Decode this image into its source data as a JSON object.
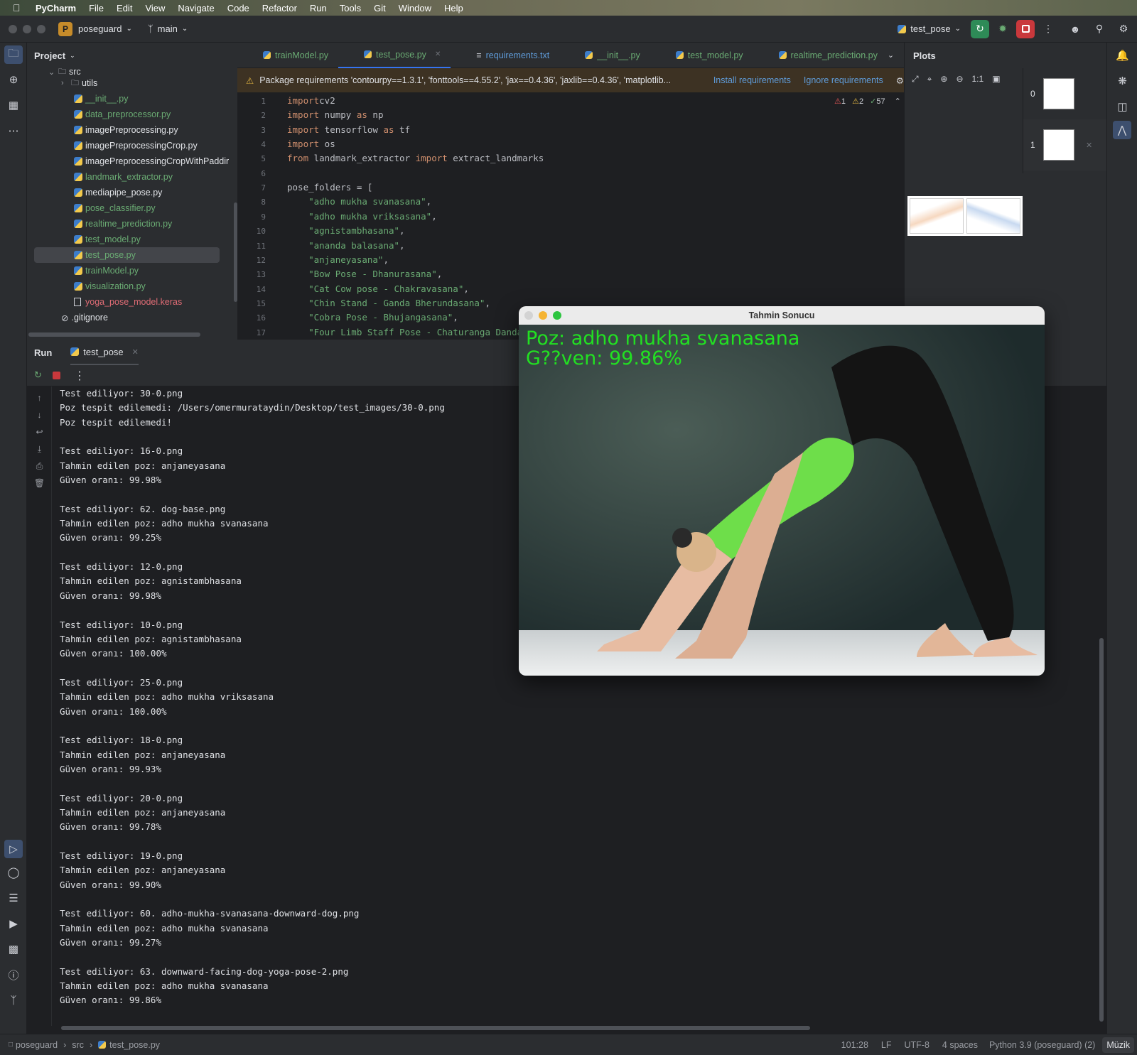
{
  "macbar": {
    "app": "PyCharm",
    "menus": [
      "File",
      "Edit",
      "View",
      "Navigate",
      "Code",
      "Refactor",
      "Run",
      "Tools",
      "Git",
      "Window",
      "Help"
    ]
  },
  "toolbar": {
    "project_badge": "P",
    "project": "poseguard",
    "branch": "main",
    "run_config": "test_pose"
  },
  "project_panel": {
    "title": "Project",
    "items": [
      {
        "name": "src",
        "type": "folder",
        "indent": 1
      },
      {
        "name": "utils",
        "type": "folder",
        "indent": 2
      },
      {
        "name": "__init__.py",
        "type": "py",
        "indent": 3,
        "color": "#6aab73"
      },
      {
        "name": "data_preprocessor.py",
        "type": "py",
        "indent": 3,
        "color": "#6aab73"
      },
      {
        "name": "imagePreprocessing.py",
        "type": "py",
        "indent": 3,
        "color": "#dfe1e5"
      },
      {
        "name": "imagePreprocessingCrop.py",
        "type": "py",
        "indent": 3,
        "color": "#dfe1e5"
      },
      {
        "name": "imagePreprocessingCropWithPaddir",
        "type": "py",
        "indent": 3,
        "color": "#dfe1e5"
      },
      {
        "name": "landmark_extractor.py",
        "type": "py",
        "indent": 3,
        "color": "#6aab73"
      },
      {
        "name": "mediapipe_pose.py",
        "type": "py",
        "indent": 3,
        "color": "#dfe1e5"
      },
      {
        "name": "pose_classifier.py",
        "type": "py",
        "indent": 3,
        "color": "#6aab73"
      },
      {
        "name": "realtime_prediction.py",
        "type": "py",
        "indent": 3,
        "color": "#6aab73"
      },
      {
        "name": "test_model.py",
        "type": "py",
        "indent": 3,
        "color": "#6aab73"
      },
      {
        "name": "test_pose.py",
        "type": "py",
        "indent": 3,
        "color": "#6aab73",
        "selected": true
      },
      {
        "name": "trainModel.py",
        "type": "py",
        "indent": 3,
        "color": "#6aab73"
      },
      {
        "name": "visualization.py",
        "type": "py",
        "indent": 3,
        "color": "#6aab73"
      },
      {
        "name": "yoga_pose_model.keras",
        "type": "file",
        "indent": 3,
        "color": "#e06c75"
      },
      {
        "name": ".gitignore",
        "type": "ignore",
        "indent": 2,
        "color": "#dfe1e5"
      }
    ]
  },
  "editor_tabs": [
    {
      "label": "trainModel.py",
      "color": "#6aab73"
    },
    {
      "label": "test_pose.py",
      "color": "#6aab73",
      "active": true
    },
    {
      "label": "requirements.txt",
      "color": "#5f9bd8"
    },
    {
      "label": "__init__.py",
      "color": "#6aab73"
    },
    {
      "label": "test_model.py",
      "color": "#6aab73"
    },
    {
      "label": "realtime_prediction.py",
      "color": "#6aab73"
    }
  ],
  "banner": {
    "text": "Package requirements 'contourpy==1.3.1', 'fonttools==4.55.2', 'jax==0.4.36', 'jaxlib==0.4.36', 'matplotlib...",
    "install": "Install requirements",
    "ignore": "Ignore requirements"
  },
  "inspections": {
    "errors": "1",
    "warnings": "2",
    "ok": "57"
  },
  "code_lines": [
    {
      "n": "1",
      "parts": [
        [
          "kw",
          "import"
        ],
        [
          "",
          "cv2"
        ]
      ]
    },
    {
      "n": "2",
      "parts": [
        [
          "kw",
          "import"
        ],
        [
          "",
          " numpy "
        ],
        [
          "kw",
          "as"
        ],
        [
          "",
          " np"
        ]
      ]
    },
    {
      "n": "3",
      "parts": [
        [
          "kw",
          "import"
        ],
        [
          "",
          " tensorflow "
        ],
        [
          "kw",
          "as"
        ],
        [
          "",
          " tf"
        ]
      ]
    },
    {
      "n": "4",
      "parts": [
        [
          "kw",
          "import"
        ],
        [
          "",
          " os"
        ]
      ]
    },
    {
      "n": "5",
      "parts": [
        [
          "kw",
          "from"
        ],
        [
          "",
          " landmark_extractor "
        ],
        [
          "kw",
          "import"
        ],
        [
          "",
          " extract_landmarks"
        ]
      ]
    },
    {
      "n": "6",
      "parts": []
    },
    {
      "n": "7",
      "parts": [
        [
          "",
          "pose_folders = ["
        ]
      ]
    },
    {
      "n": "8",
      "parts": [
        [
          "st",
          "    \"adho mukha svanasana\""
        ],
        [
          "",
          ","
        ]
      ]
    },
    {
      "n": "9",
      "parts": [
        [
          "st",
          "    \"adho mukha vriksasana\""
        ],
        [
          "",
          ","
        ]
      ]
    },
    {
      "n": "10",
      "parts": [
        [
          "st",
          "    \"agnistambhasana\""
        ],
        [
          "",
          ","
        ]
      ]
    },
    {
      "n": "11",
      "parts": [
        [
          "st",
          "    \"ananda balasana\""
        ],
        [
          "",
          ","
        ]
      ]
    },
    {
      "n": "12",
      "parts": [
        [
          "st",
          "    \"anjaneyasana\""
        ],
        [
          "",
          ","
        ]
      ]
    },
    {
      "n": "13",
      "parts": [
        [
          "st",
          "    \"Bow Pose - Dhanurasana\""
        ],
        [
          "",
          ","
        ]
      ]
    },
    {
      "n": "14",
      "parts": [
        [
          "st",
          "    \"Cat Cow pose - Chakravasana\""
        ],
        [
          "",
          ","
        ]
      ]
    },
    {
      "n": "15",
      "parts": [
        [
          "st",
          "    \"Chin Stand - Ganda Bherundasana\""
        ],
        [
          "",
          ","
        ]
      ]
    },
    {
      "n": "16",
      "parts": [
        [
          "st",
          "    \"Cobra Pose - Bhujangasana\""
        ],
        [
          "",
          ","
        ]
      ]
    },
    {
      "n": "17",
      "parts": [
        [
          "st",
          "    \"Four Limb Staff Pose - Chaturanga Danda"
        ]
      ]
    }
  ],
  "plots": {
    "title": "Plots",
    "zoom": "1:1",
    "thumbs": [
      "0",
      "1"
    ]
  },
  "run": {
    "title": "Run",
    "tab": "test_pose"
  },
  "console": [
    "Test ediliyor: 30-0.png",
    "Poz tespit edilemedi: /Users/omermurataydin/Desktop/test_images/30-0.png",
    "Poz tespit edilemedi!",
    "",
    "Test ediliyor: 16-0.png",
    "Tahmin edilen poz: anjaneyasana",
    "Güven oranı: 99.98%",
    "",
    "Test ediliyor: 62. dog-base.png",
    "Tahmin edilen poz: adho mukha svanasana",
    "Güven oranı: 99.25%",
    "",
    "Test ediliyor: 12-0.png",
    "Tahmin edilen poz: agnistambhasana",
    "Güven oranı: 99.98%",
    "",
    "Test ediliyor: 10-0.png",
    "Tahmin edilen poz: agnistambhasana",
    "Güven oranı: 100.00%",
    "",
    "Test ediliyor: 25-0.png",
    "Tahmin edilen poz: adho mukha vriksasana",
    "Güven oranı: 100.00%",
    "",
    "Test ediliyor: 18-0.png",
    "Tahmin edilen poz: anjaneyasana",
    "Güven oranı: 99.93%",
    "",
    "Test ediliyor: 20-0.png",
    "Tahmin edilen poz: anjaneyasana",
    "Güven oranı: 99.78%",
    "",
    "Test ediliyor: 19-0.png",
    "Tahmin edilen poz: anjaneyasana",
    "Güven oranı: 99.90%",
    "",
    "Test ediliyor: 60. adho-mukha-svanasana-downward-dog.png",
    "Tahmin edilen poz: adho mukha svanasana",
    "Güven oranı: 99.27%",
    "",
    "Test ediliyor: 63. downward-facing-dog-yoga-pose-2.png",
    "Tahmin edilen poz: adho mukha svanasana",
    "Güven oranı: 99.86%"
  ],
  "popup": {
    "title": "Tahmin Sonucu",
    "line1": "Poz: adho mukha svanasana",
    "line2": "G??ven: 99.86%"
  },
  "status": {
    "crumbs": [
      "poseguard",
      "src",
      "test_pose.py"
    ],
    "position": "101:28",
    "line_sep": "LF",
    "encoding": "UTF-8",
    "indent": "4 spaces",
    "interpreter": "Python 3.9 (poseguard) (2)",
    "music": "Müzik"
  }
}
